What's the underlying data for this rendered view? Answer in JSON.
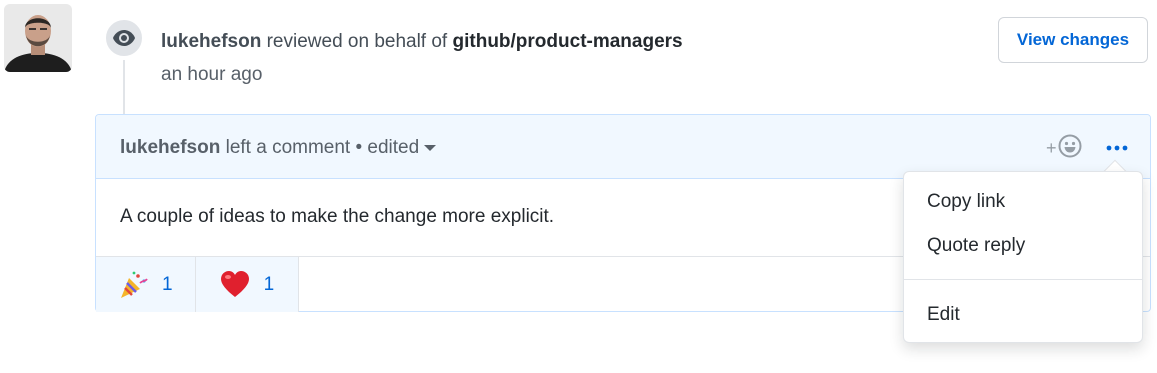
{
  "review": {
    "username": "lukehefson",
    "action": "reviewed on behalf of",
    "org": "github/product-managers",
    "time": "an hour ago",
    "view_changes_label": "View changes"
  },
  "comment": {
    "username": "lukehefson",
    "action": "left a comment",
    "separator": "•",
    "edited_label": "edited",
    "body": "A couple of ideas to make the change more explicit.",
    "add_reaction_plus": "+",
    "reactions": [
      {
        "emoji": "party-popper-icon",
        "count": "1"
      },
      {
        "emoji": "heart-icon",
        "count": "1"
      }
    ]
  },
  "menu": {
    "items": [
      "Copy link",
      "Quote reply",
      "Edit"
    ]
  },
  "colors": {
    "link_blue": "#0366d6",
    "header_bg": "#f1f8ff",
    "border_blue": "#c8e1ff"
  }
}
